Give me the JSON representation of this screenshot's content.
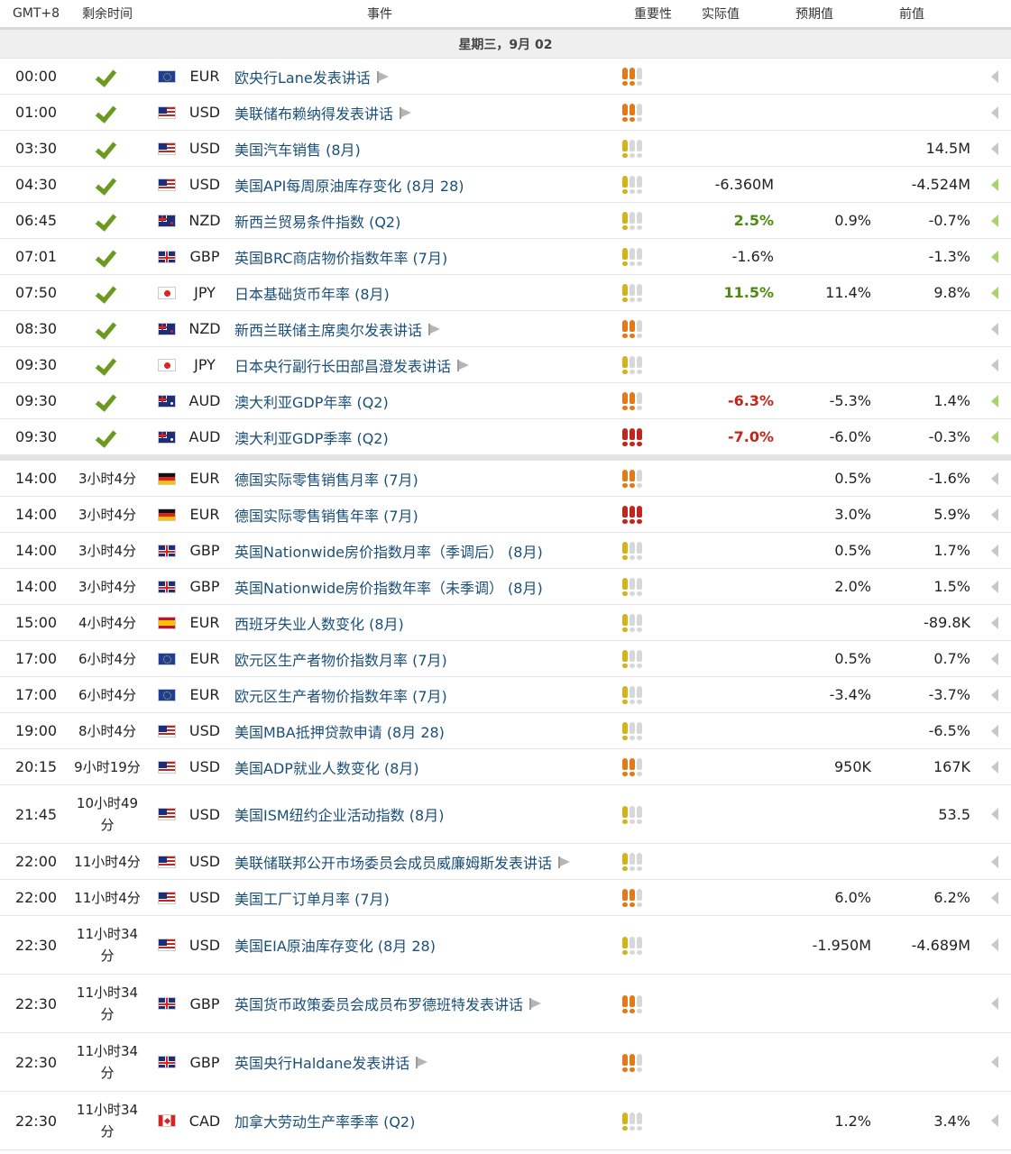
{
  "header": {
    "tz": "GMT+8",
    "remaining": "剩余时间",
    "event": "事件",
    "importance": "重要性",
    "actual": "实际值",
    "forecast": "预期值",
    "previous": "前值"
  },
  "date_label": "星期三，9月 02",
  "colors": {
    "bull_high": "#c0271e",
    "bull_med": "#e07a1a",
    "bull_low": "#d4b21a",
    "bull_off": "#d8d8d8",
    "link": "#1a4f7a",
    "check": "#6a9a1f"
  },
  "past_rows": [
    {
      "time": "00:00",
      "cur": "EUR",
      "flag": "eu",
      "event": "欧央行Lane发表讲话",
      "speech": true,
      "imp": 2,
      "act": "",
      "act_class": "",
      "fore": "",
      "prev": "",
      "arrow": "gray"
    },
    {
      "time": "01:00",
      "cur": "USD",
      "flag": "us",
      "event": "美联储布赖纳得发表讲话",
      "speech": true,
      "imp": 2,
      "act": "",
      "act_class": "",
      "fore": "",
      "prev": "",
      "arrow": "gray"
    },
    {
      "time": "03:30",
      "cur": "USD",
      "flag": "us",
      "event": "美国汽车销售 (8月)",
      "speech": false,
      "imp": 1,
      "act": "",
      "act_class": "",
      "fore": "",
      "prev": "14.5M",
      "arrow": "gray"
    },
    {
      "time": "04:30",
      "cur": "USD",
      "flag": "us",
      "event": "美国API每周原油库存变化 (8月 28)",
      "speech": false,
      "imp": 1,
      "act": "-6.360M",
      "act_class": "",
      "fore": "",
      "prev": "-4.524M",
      "arrow": "green"
    },
    {
      "time": "06:45",
      "cur": "NZD",
      "flag": "nz",
      "event": "新西兰贸易条件指数 (Q2)",
      "speech": false,
      "imp": 1,
      "act": "2.5%",
      "act_class": "green",
      "fore": "0.9%",
      "prev": "-0.7%",
      "arrow": "green"
    },
    {
      "time": "07:01",
      "cur": "GBP",
      "flag": "gb",
      "event": "英国BRC商店物价指数年率 (7月)",
      "speech": false,
      "imp": 1,
      "act": "-1.6%",
      "act_class": "",
      "fore": "",
      "prev": "-1.3%",
      "arrow": "green"
    },
    {
      "time": "07:50",
      "cur": "JPY",
      "flag": "jp",
      "event": "日本基础货币年率 (8月)",
      "speech": false,
      "imp": 1,
      "act": "11.5%",
      "act_class": "green",
      "fore": "11.4%",
      "prev": "9.8%",
      "arrow": "green"
    },
    {
      "time": "08:30",
      "cur": "NZD",
      "flag": "nz",
      "event": "新西兰联储主席奥尔发表讲话",
      "speech": true,
      "imp": 2,
      "act": "",
      "act_class": "",
      "fore": "",
      "prev": "",
      "arrow": "gray"
    },
    {
      "time": "09:30",
      "cur": "JPY",
      "flag": "jp",
      "event": "日本央行副行长田部昌澄发表讲话",
      "speech": true,
      "imp": 1,
      "act": "",
      "act_class": "",
      "fore": "",
      "prev": "",
      "arrow": "gray"
    },
    {
      "time": "09:30",
      "cur": "AUD",
      "flag": "au",
      "event": "澳大利亚GDP年率 (Q2)",
      "speech": false,
      "imp": 2,
      "act": "-6.3%",
      "act_class": "red",
      "fore": "-5.3%",
      "prev": "1.4%",
      "arrow": "green"
    },
    {
      "time": "09:30",
      "cur": "AUD",
      "flag": "au",
      "event": "澳大利亚GDP季率 (Q2)",
      "speech": false,
      "imp": 3,
      "act": "-7.0%",
      "act_class": "red",
      "fore": "-6.0%",
      "prev": "-0.3%",
      "arrow": "green"
    }
  ],
  "future_rows": [
    {
      "time": "14:00",
      "remain": "3小时4分",
      "tall": false,
      "cur": "EUR",
      "flag": "de",
      "event": "德国实际零售销售月率 (7月)",
      "speech": false,
      "imp": 2,
      "fore": "0.5%",
      "prev": "-1.6%"
    },
    {
      "time": "14:00",
      "remain": "3小时4分",
      "tall": false,
      "cur": "EUR",
      "flag": "de",
      "event": "德国实际零售销售年率 (7月)",
      "speech": false,
      "imp": 3,
      "fore": "3.0%",
      "prev": "5.9%"
    },
    {
      "time": "14:00",
      "remain": "3小时4分",
      "tall": false,
      "cur": "GBP",
      "flag": "gb",
      "event": "英国Nationwide房价指数月率（季调后） (8月)",
      "speech": false,
      "imp": 1,
      "fore": "0.5%",
      "prev": "1.7%"
    },
    {
      "time": "14:00",
      "remain": "3小时4分",
      "tall": false,
      "cur": "GBP",
      "flag": "gb",
      "event": "英国Nationwide房价指数年率（未季调） (8月)",
      "speech": false,
      "imp": 1,
      "fore": "2.0%",
      "prev": "1.5%"
    },
    {
      "time": "15:00",
      "remain": "4小时4分",
      "tall": false,
      "cur": "EUR",
      "flag": "es",
      "event": "西班牙失业人数变化 (8月)",
      "speech": false,
      "imp": 1,
      "fore": "",
      "prev": "-89.8K"
    },
    {
      "time": "17:00",
      "remain": "6小时4分",
      "tall": false,
      "cur": "EUR",
      "flag": "eu",
      "event": "欧元区生产者物价指数月率 (7月)",
      "speech": false,
      "imp": 1,
      "fore": "0.5%",
      "prev": "0.7%"
    },
    {
      "time": "17:00",
      "remain": "6小时4分",
      "tall": false,
      "cur": "EUR",
      "flag": "eu",
      "event": "欧元区生产者物价指数年率 (7月)",
      "speech": false,
      "imp": 1,
      "fore": "-3.4%",
      "prev": "-3.7%"
    },
    {
      "time": "19:00",
      "remain": "8小时4分",
      "tall": false,
      "cur": "USD",
      "flag": "us",
      "event": "美国MBA抵押贷款申请 (8月 28)",
      "speech": false,
      "imp": 1,
      "fore": "",
      "prev": "-6.5%"
    },
    {
      "time": "20:15",
      "remain": "9小时19分",
      "tall": false,
      "cur": "USD",
      "flag": "us",
      "event": "美国ADP就业人数变化 (8月)",
      "speech": false,
      "imp": 2,
      "fore": "950K",
      "prev": "167K"
    },
    {
      "time": "21:45",
      "remain": "10小时49分",
      "tall": true,
      "cur": "USD",
      "flag": "us",
      "event": "美国ISM纽约企业活动指数 (8月)",
      "speech": false,
      "imp": 1,
      "fore": "",
      "prev": "53.5"
    },
    {
      "time": "22:00",
      "remain": "11小时4分",
      "tall": false,
      "cur": "USD",
      "flag": "us",
      "event": "美联储联邦公开市场委员会成员威廉姆斯发表讲话",
      "speech": true,
      "imp": 1,
      "fore": "",
      "prev": ""
    },
    {
      "time": "22:00",
      "remain": "11小时4分",
      "tall": false,
      "cur": "USD",
      "flag": "us",
      "event": "美国工厂订单月率 (7月)",
      "speech": false,
      "imp": 2,
      "fore": "6.0%",
      "prev": "6.2%"
    },
    {
      "time": "22:30",
      "remain": "11小时34分",
      "tall": true,
      "cur": "USD",
      "flag": "us",
      "event": "美国EIA原油库存变化 (8月 28)",
      "speech": false,
      "imp": 1,
      "fore": "-1.950M",
      "prev": "-4.689M"
    },
    {
      "time": "22:30",
      "remain": "11小时34分",
      "tall": true,
      "cur": "GBP",
      "flag": "gb",
      "event": "英国货币政策委员会成员布罗德班特发表讲话",
      "speech": true,
      "imp": 2,
      "fore": "",
      "prev": ""
    },
    {
      "time": "22:30",
      "remain": "11小时34分",
      "tall": true,
      "cur": "GBP",
      "flag": "gb",
      "event": "英国央行Haldane发表讲话",
      "speech": true,
      "imp": 2,
      "fore": "",
      "prev": ""
    },
    {
      "time": "22:30",
      "remain": "11小时34分",
      "tall": true,
      "cur": "CAD",
      "flag": "ca",
      "event": "加拿大劳动生产率季率 (Q2)",
      "speech": false,
      "imp": 1,
      "fore": "1.2%",
      "prev": "3.4%"
    }
  ]
}
